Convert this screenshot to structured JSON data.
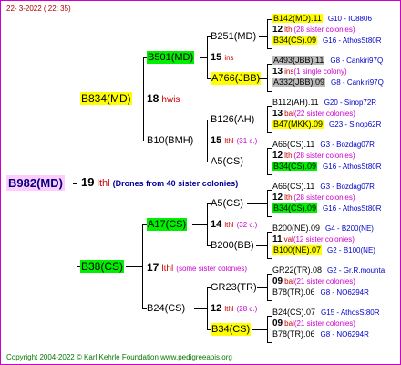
{
  "date": "22-  3-2022 ( 22: 35)",
  "copyright": "Copyright 2004-2022 © Karl Kehrle Foundation    www.pedigreeapis.org",
  "root": {
    "name": "B982(MD)",
    "gen": "19",
    "ithl": "lthl",
    "note": "(Drones from 40 sister colonies)"
  },
  "p": {
    "upper": {
      "name": "B834(MD)",
      "gen": "18",
      "q": "hwis"
    },
    "lower": {
      "name": "B38(CS)",
      "gen": "17",
      "q": "lthl",
      "note": "(some sister colonies)"
    }
  },
  "g": {
    "b501": {
      "name": "B501(MD)",
      "gen": "15",
      "q": "ins"
    },
    "b10": {
      "name": "B10(BMH)",
      "gen": "15",
      "q": "lthl",
      "note": "(31 c.)"
    },
    "a17": {
      "name": "A17(CS)",
      "gen": "14",
      "q": "lthl",
      "note": "(32 c.)"
    },
    "b24": {
      "name": "B24(CS)",
      "gen": "12",
      "q": "lthl",
      "note": "(28 c.)"
    }
  },
  "gg": [
    {
      "name": "B251(MD)"
    },
    {
      "name": "A766(JBB)"
    },
    {
      "name": "B126(AH)"
    },
    {
      "name": "A5(CS)"
    },
    {
      "name": "A5(CS)"
    },
    {
      "name": "B200(BB)"
    },
    {
      "name": "GR23(TR)"
    },
    {
      "name": "B34(CS)"
    }
  ],
  "leaves": [
    {
      "top": "B142(MD).11",
      "topCode": "G10 - IC8806",
      "gen": "12",
      "q": "lthl",
      "note": "(28 sister colonies)",
      "bottom": "B34(CS).09",
      "bottomCode": "G16 - AthosSt80R"
    },
    {
      "top": "A493(JBB).11",
      "topCode": "G8 - Cankiri97Q",
      "gen": "13",
      "q": "ins",
      "note": "(1 single colony)",
      "bottom": "A332(JBB).09",
      "bottomCode": "G8 - Cankiri97Q"
    },
    {
      "top": "B112(AH).11",
      "topCode": "G20 - Sinop72R",
      "gen": "13",
      "q": "bal",
      "note": "(22 sister colonies)",
      "bottom": "B47(MKK).09",
      "bottomCode": "G23 - Sinop62R"
    },
    {
      "top": "A66(CS).11",
      "topCode": "G3 - Bozdag07R",
      "gen": "12",
      "q": "lthl",
      "note": "(28 sister colonies)",
      "bottom": "B34(CS).09",
      "bottomCode": "G16 - AthosSt80R"
    },
    {
      "top": "A66(CS).11",
      "topCode": "G3 - Bozdag07R",
      "gen": "12",
      "q": "lthl",
      "note": "(28 sister colonies)",
      "bottom": "B34(CS).09",
      "bottomCode": "G16 - AthosSt80R"
    },
    {
      "top": "B200(NE).09",
      "topCode": "G4 - B200(NE)",
      "gen": "11",
      "q": "val",
      "note": "(12 sister colonies)",
      "bottom": "B100(NE).07",
      "bottomCode": "G2 - B100(NE)"
    },
    {
      "top": "GR22(TR).08",
      "topCode": "G2 - Gr.R.mounta",
      "gen": "09",
      "q": "bal",
      "note": "(21 sister colonies)",
      "bottom": "B78(TR).06",
      "bottomCode": "G8 - NO6294R"
    },
    {
      "top": "B24(CS).07",
      "topCode": "G15 - AthosSt80R",
      "gen": "09",
      "q": "bal",
      "note": "(21 sister colonies)",
      "bottom": "B78(TR).06",
      "bottomCode": "G8 - NO6294R"
    }
  ]
}
